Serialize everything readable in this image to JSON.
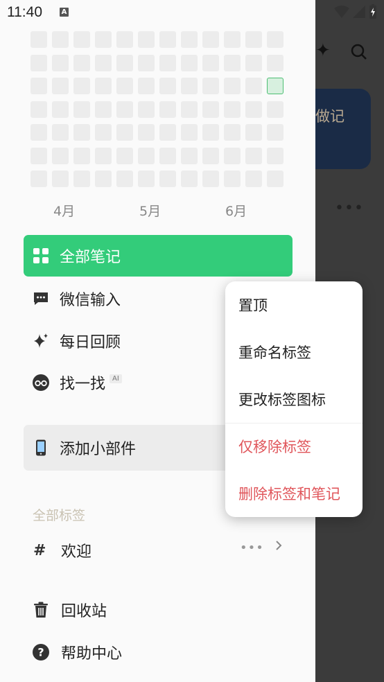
{
  "status_bar": {
    "time": "11:40",
    "indicator": "A"
  },
  "heatmap": {
    "rows": 7,
    "cols": 12,
    "active_cells": [
      {
        "row": 2,
        "col": 11
      }
    ],
    "months": [
      "4月",
      "5月",
      "6月"
    ]
  },
  "nav": {
    "items": [
      {
        "label": "全部笔记",
        "icon": "grid-icon",
        "active": true
      },
      {
        "label": "微信输入",
        "icon": "chat-bubble-icon"
      },
      {
        "label": "每日回顾",
        "icon": "sparkle-icon"
      },
      {
        "label": "找一找",
        "icon": "glasses-icon",
        "badge": "AI"
      }
    ],
    "widget": {
      "label": "添加小部件",
      "icon": "phone-icon"
    }
  },
  "tags": {
    "section_title": "全部标签",
    "items": [
      {
        "label": "欢迎",
        "icon": "hash-icon"
      }
    ]
  },
  "bottom": {
    "trash_label": "回收站",
    "help_label": "帮助中心"
  },
  "context_menu": {
    "items": [
      {
        "label": "置顶",
        "danger": false
      },
      {
        "label": "重命名标签",
        "danger": false
      },
      {
        "label": "更改标签图标",
        "danger": false
      },
      {
        "label": "仅移除标签",
        "danger": true
      },
      {
        "label": "删除标签和笔记",
        "danger": true
      }
    ]
  },
  "background": {
    "card_text": "做记"
  },
  "colors": {
    "accent": "#33cc7a",
    "danger": "#e0565b",
    "overlay": "#3b3b3b"
  }
}
